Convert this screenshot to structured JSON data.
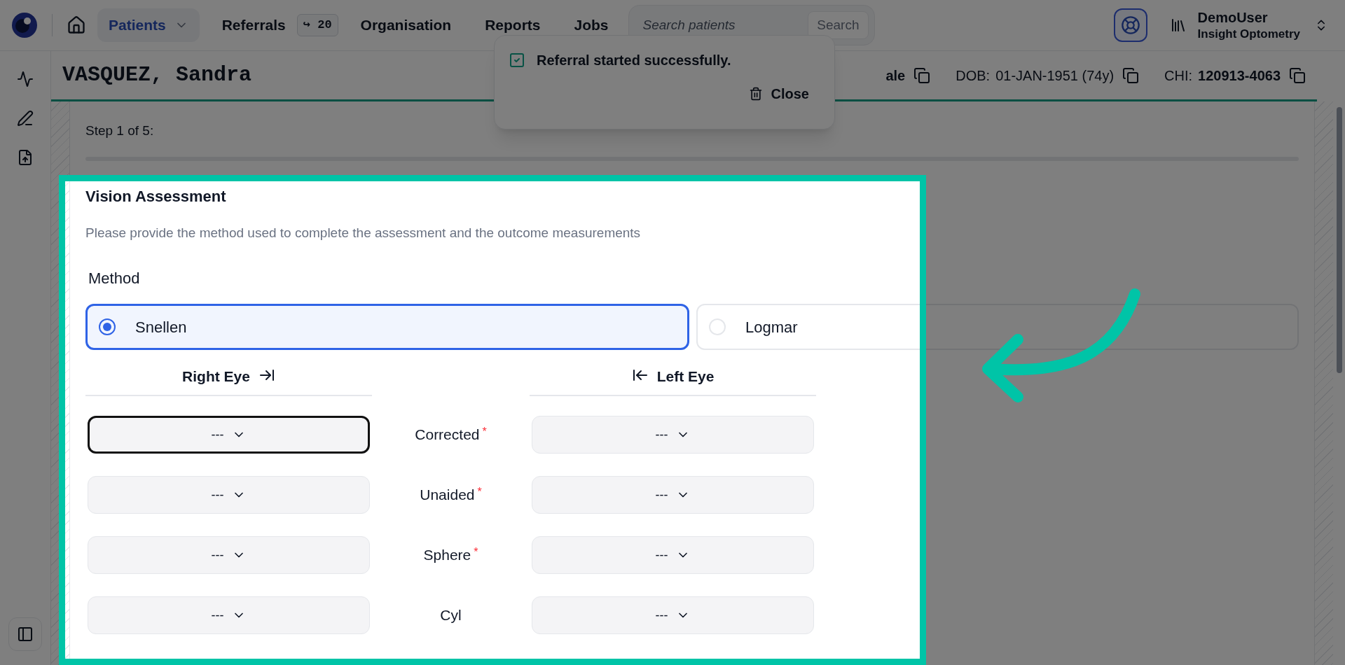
{
  "nav": {
    "items": [
      {
        "label": "Patients",
        "selected": true,
        "kind": "dropdown"
      },
      {
        "label": "Referrals",
        "selected": false,
        "kind": "badge",
        "badge": "↪ 20"
      },
      {
        "label": "Organisation",
        "selected": false,
        "kind": "link"
      },
      {
        "label": "Reports",
        "selected": false,
        "kind": "link"
      },
      {
        "label": "Jobs",
        "selected": false,
        "kind": "link"
      }
    ],
    "search": {
      "placeholder": "Search patients",
      "button": "Search"
    },
    "user": {
      "name": "DemoUser",
      "org": "Insight Optometry"
    }
  },
  "header": {
    "name": "VASQUEZ, Sandra",
    "sex": "ale",
    "dob_label": "DOB:",
    "dob": "01-JAN-1951 (74y)",
    "chi_label": "CHI:",
    "chi": "120913-4063"
  },
  "toast": {
    "message": "Referral started successfully.",
    "action": "Close"
  },
  "step": "Step 1 of 5:",
  "form": {
    "title": "Vision Assessment",
    "description": "Please provide the method used to complete the assessment and the outcome measurements",
    "method_label": "Method",
    "methods": [
      {
        "label": "Snellen",
        "selected": true
      },
      {
        "label": "Logmar",
        "selected": false
      }
    ],
    "required_marker": "*",
    "right_eye": "Right Eye",
    "left_eye": "Left Eye",
    "rows": [
      {
        "label": "Corrected",
        "required": true,
        "right": {
          "value": "---",
          "focused": true
        },
        "left": {
          "value": "---",
          "focused": false
        }
      },
      {
        "label": "Unaided",
        "required": true,
        "right": {
          "value": "---",
          "focused": false
        },
        "left": {
          "value": "---",
          "focused": false
        }
      },
      {
        "label": "Sphere",
        "required": true,
        "right": {
          "value": "---",
          "focused": false
        },
        "left": {
          "value": "---",
          "focused": false
        }
      },
      {
        "label": "Cyl",
        "required": false,
        "right": {
          "value": "---",
          "focused": false
        },
        "left": {
          "value": "---",
          "focused": false
        }
      }
    ]
  }
}
